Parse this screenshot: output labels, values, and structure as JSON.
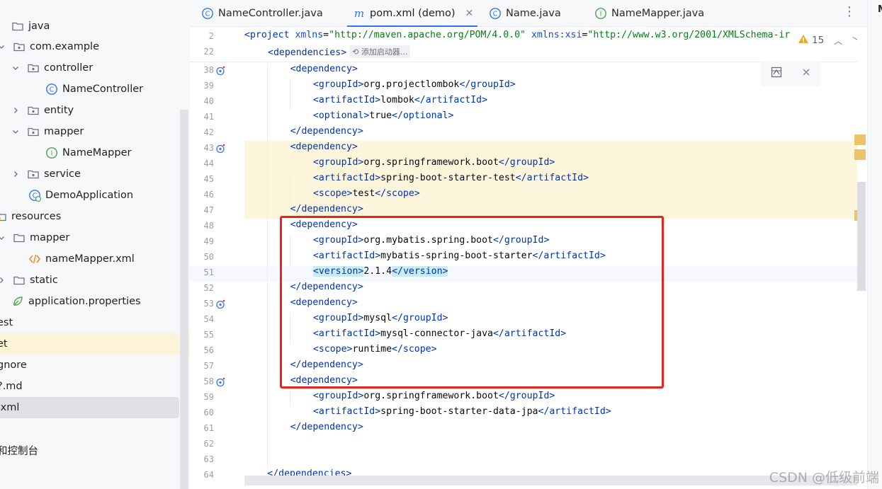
{
  "tree": {
    "items": [
      {
        "label": "java",
        "icon": "folder-icon"
      },
      {
        "label": "com.example",
        "icon": "package-icon"
      },
      {
        "label": "controller",
        "icon": "package-icon"
      },
      {
        "label": "NameController",
        "icon": "class-icon"
      },
      {
        "label": "entity",
        "icon": "package-icon"
      },
      {
        "label": "mapper",
        "icon": "package-icon"
      },
      {
        "label": "NameMapper",
        "icon": "interface-icon"
      },
      {
        "label": "service",
        "icon": "package-icon"
      },
      {
        "label": "DemoApplication",
        "icon": "spring-class-icon"
      },
      {
        "label": "resources",
        "icon": "resources-folder-icon"
      },
      {
        "label": "mapper",
        "icon": "folder-icon"
      },
      {
        "label": "nameMapper.xml",
        "icon": "xml-file-icon"
      },
      {
        "label": "static",
        "icon": "folder-icon"
      },
      {
        "label": "application.properties",
        "icon": "spring-properties-icon"
      },
      {
        "label": "est"
      },
      {
        "label": "et"
      },
      {
        "label": "gnore"
      },
      {
        "label": "?.md"
      },
      {
        "label": ".xml"
      },
      {
        "label": "和控制台"
      }
    ]
  },
  "tabs": [
    {
      "label": "NameController.java",
      "icon": "class-icon"
    },
    {
      "label": "pom.xml (demo)",
      "icon": "maven-icon",
      "active": true
    },
    {
      "label": "Name.java",
      "icon": "class-icon"
    },
    {
      "label": "NameMapper.java",
      "icon": "interface-icon"
    }
  ],
  "tab_close": "✕",
  "tab_menu": "⋮",
  "right_strip_label": "M",
  "editor": {
    "warnings_count": "15",
    "sticky": {
      "line2_num": "2",
      "line2": {
        "open": "<project ",
        "a1": "xmlns",
        "eq1": "=",
        "v1": "\"http://maven.apache.org/POM/4.0.0\"",
        "sp": " ",
        "a2": "xmlns:xsi",
        "eq2": "=",
        "v2": "\"http://www.w3.org/2001/XMLSchema-ir"
      },
      "line22_num": "22",
      "line22_tag": "<dependencies>",
      "hint": "添加启动器..."
    },
    "lines": [
      {
        "n": "38",
        "indent": 2,
        "t": "<dependency>"
      },
      {
        "n": "39",
        "indent": 3,
        "open": "<groupId>",
        "v": "org.projectlombok",
        "close": "</groupId>"
      },
      {
        "n": "40",
        "indent": 3,
        "open": "<artifactId>",
        "v": "lombok",
        "close": "</artifactId>"
      },
      {
        "n": "41",
        "indent": 3,
        "open": "<optional>",
        "v": "true",
        "close": "</optional>"
      },
      {
        "n": "42",
        "indent": 2,
        "t": "</dependency>"
      },
      {
        "n": "43",
        "indent": 2,
        "t": "<dependency>"
      },
      {
        "n": "44",
        "indent": 3,
        "open": "<groupId>",
        "v": "org.springframework.boot",
        "close": "</groupId>"
      },
      {
        "n": "45",
        "indent": 3,
        "open": "<artifactId>",
        "v": "spring-boot-starter-test",
        "close": "</artifactId>"
      },
      {
        "n": "46",
        "indent": 3,
        "open": "<scope>",
        "v": "test",
        "close": "</scope>"
      },
      {
        "n": "47",
        "indent": 2,
        "t": "</dependency>"
      },
      {
        "n": "48",
        "indent": 2,
        "t": "<dependency>"
      },
      {
        "n": "49",
        "indent": 3,
        "open": "<groupId>",
        "v": "org.mybatis.spring.boot",
        "close": "</groupId>"
      },
      {
        "n": "50",
        "indent": 3,
        "open": "<artifactId>",
        "v": "mybatis-spring-boot-starter",
        "close": "</artifactId>"
      },
      {
        "n": "51",
        "indent": 3,
        "open": "<version>",
        "v": "2.1.4",
        "close": "</version>"
      },
      {
        "n": "52",
        "indent": 2,
        "t": "</dependency>"
      },
      {
        "n": "53",
        "indent": 2,
        "t": "<dependency>"
      },
      {
        "n": "54",
        "indent": 3,
        "open": "<groupId>",
        "v": "mysql",
        "close": "</groupId>"
      },
      {
        "n": "55",
        "indent": 3,
        "open": "<artifactId>",
        "v": "mysql-connector-java",
        "close": "</artifactId>"
      },
      {
        "n": "56",
        "indent": 3,
        "open": "<scope>",
        "v": "runtime",
        "close": "</scope>"
      },
      {
        "n": "57",
        "indent": 2,
        "t": "</dependency>"
      },
      {
        "n": "58",
        "indent": 2,
        "t": "<dependency>"
      },
      {
        "n": "59",
        "indent": 3,
        "open": "<groupId>",
        "v": "org.springframework.boot",
        "close": "</groupId>"
      },
      {
        "n": "60",
        "indent": 3,
        "open": "<artifactId>",
        "v": "spring-boot-starter-data-jpa",
        "close": "</artifactId>"
      },
      {
        "n": "61",
        "indent": 2,
        "t": "</dependency>"
      },
      {
        "n": "62",
        "indent": 0,
        "t": ""
      },
      {
        "n": "63",
        "indent": 0,
        "t": ""
      },
      {
        "n": "64",
        "indent": 1,
        "t": "</dependencies>"
      }
    ]
  },
  "watermark": "CSDN @低级前端",
  "colors": {
    "accent": "#3574f0",
    "highlight_box": "#e8241e",
    "warning": "#edc36a"
  }
}
